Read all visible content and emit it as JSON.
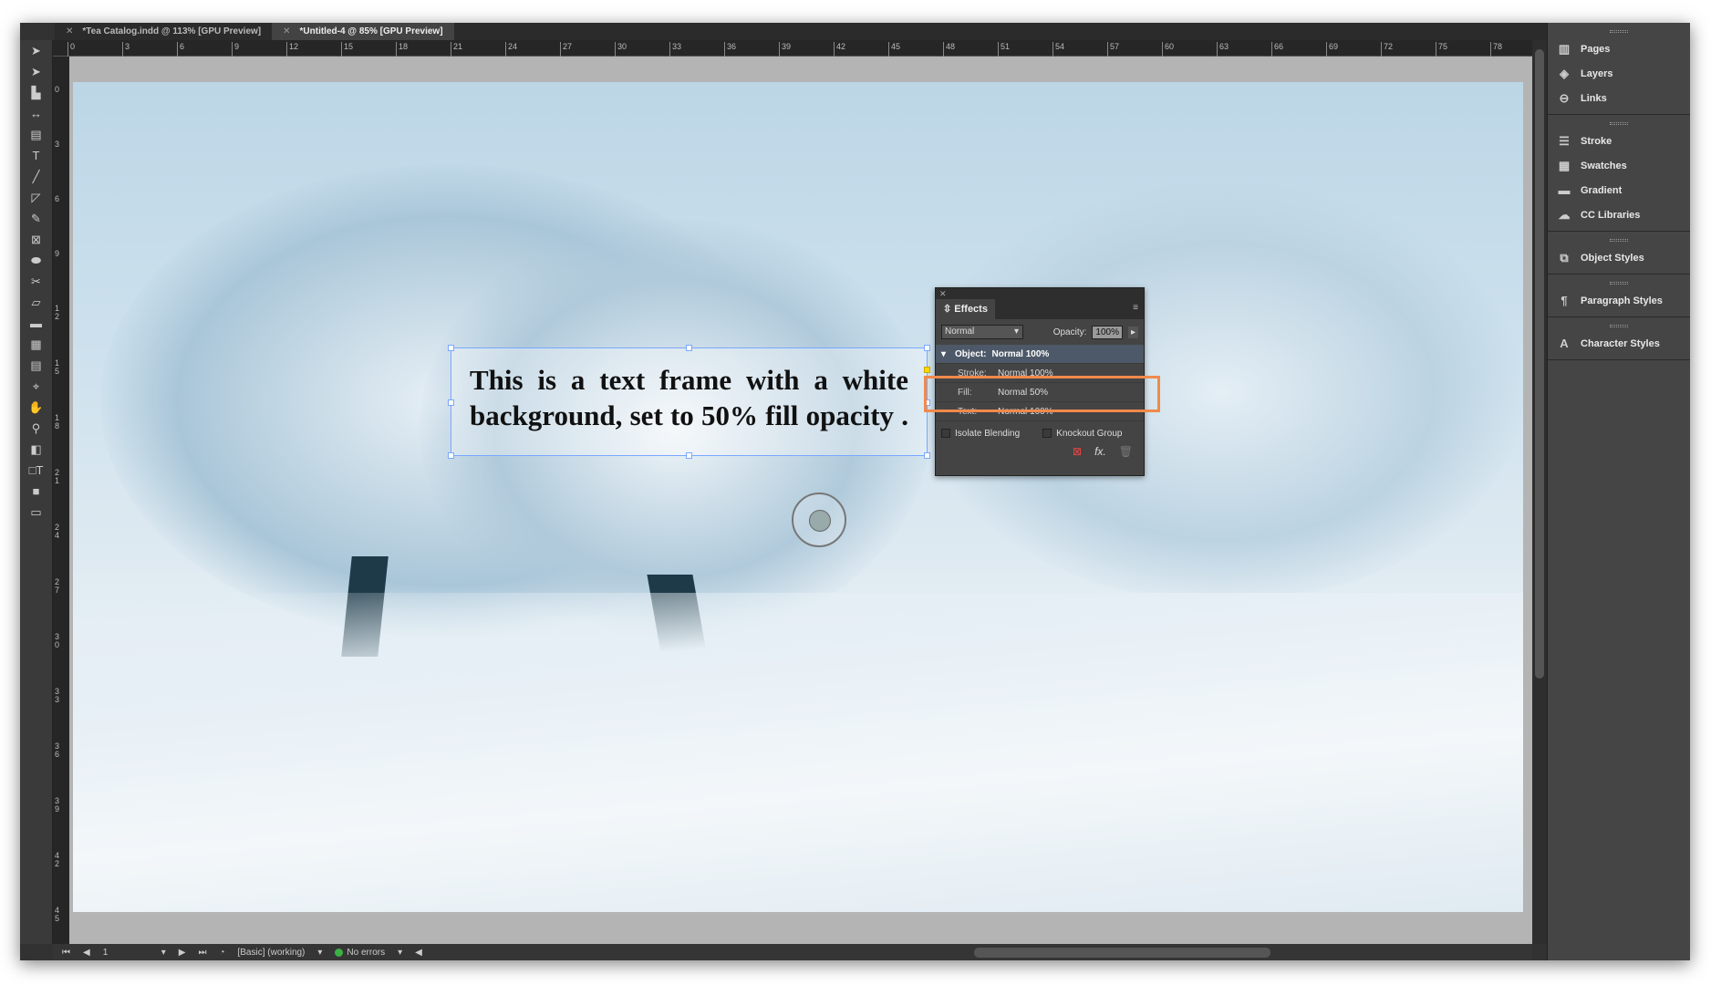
{
  "tabs": [
    {
      "label": "*Tea Catalog.indd @ 113% [GPU Preview]",
      "active": false
    },
    {
      "label": "*Untitled-4 @ 85% [GPU Preview]",
      "active": true
    }
  ],
  "ruler_top": [
    "0",
    "3",
    "6",
    "9",
    "12",
    "15",
    "18",
    "21",
    "24",
    "27",
    "30",
    "33",
    "36",
    "39",
    "42",
    "45",
    "48",
    "51",
    "54",
    "57",
    "60",
    "63",
    "66",
    "69",
    "72",
    "75",
    "78"
  ],
  "ruler_left": [
    "0",
    "3",
    "6",
    "9",
    "12",
    "15",
    "18",
    "21",
    "24",
    "27",
    "30",
    "33",
    "36",
    "39",
    "42",
    "45"
  ],
  "text_frame": {
    "content": "This is a text frame with a white background, set to 50% fill opacity ."
  },
  "effects": {
    "title": "Effects",
    "blend_mode": "Normal",
    "opacity_label": "Opacity:",
    "opacity": "100%",
    "object_label": "Object:",
    "object_value": "Normal 100%",
    "rows": [
      {
        "label": "Stroke:",
        "value": "Normal 100%"
      },
      {
        "label": "Fill:",
        "value": "Normal 50%"
      },
      {
        "label": "Text:",
        "value": "Normal 100%"
      }
    ],
    "isolate": "Isolate Blending",
    "knockout": "Knockout Group",
    "highlight_color": "#f08a4b"
  },
  "panels": [
    [
      {
        "label": "Pages",
        "icon": "pages-icon"
      },
      {
        "label": "Layers",
        "icon": "layers-icon"
      },
      {
        "label": "Links",
        "icon": "links-icon"
      }
    ],
    [
      {
        "label": "Stroke",
        "icon": "stroke-icon"
      },
      {
        "label": "Swatches",
        "icon": "swatches-icon"
      },
      {
        "label": "Gradient",
        "icon": "gradient-icon"
      },
      {
        "label": "CC Libraries",
        "icon": "cc-libraries-icon"
      }
    ],
    [
      {
        "label": "Object Styles",
        "icon": "object-styles-icon"
      }
    ],
    [
      {
        "label": "Paragraph Styles",
        "icon": "paragraph-styles-icon"
      }
    ],
    [
      {
        "label": "Character Styles",
        "icon": "character-styles-icon"
      }
    ]
  ],
  "status": {
    "page": "1",
    "preflight_profile": "[Basic] (working)",
    "errors": "No errors",
    "ok_color": "#3cb043"
  }
}
